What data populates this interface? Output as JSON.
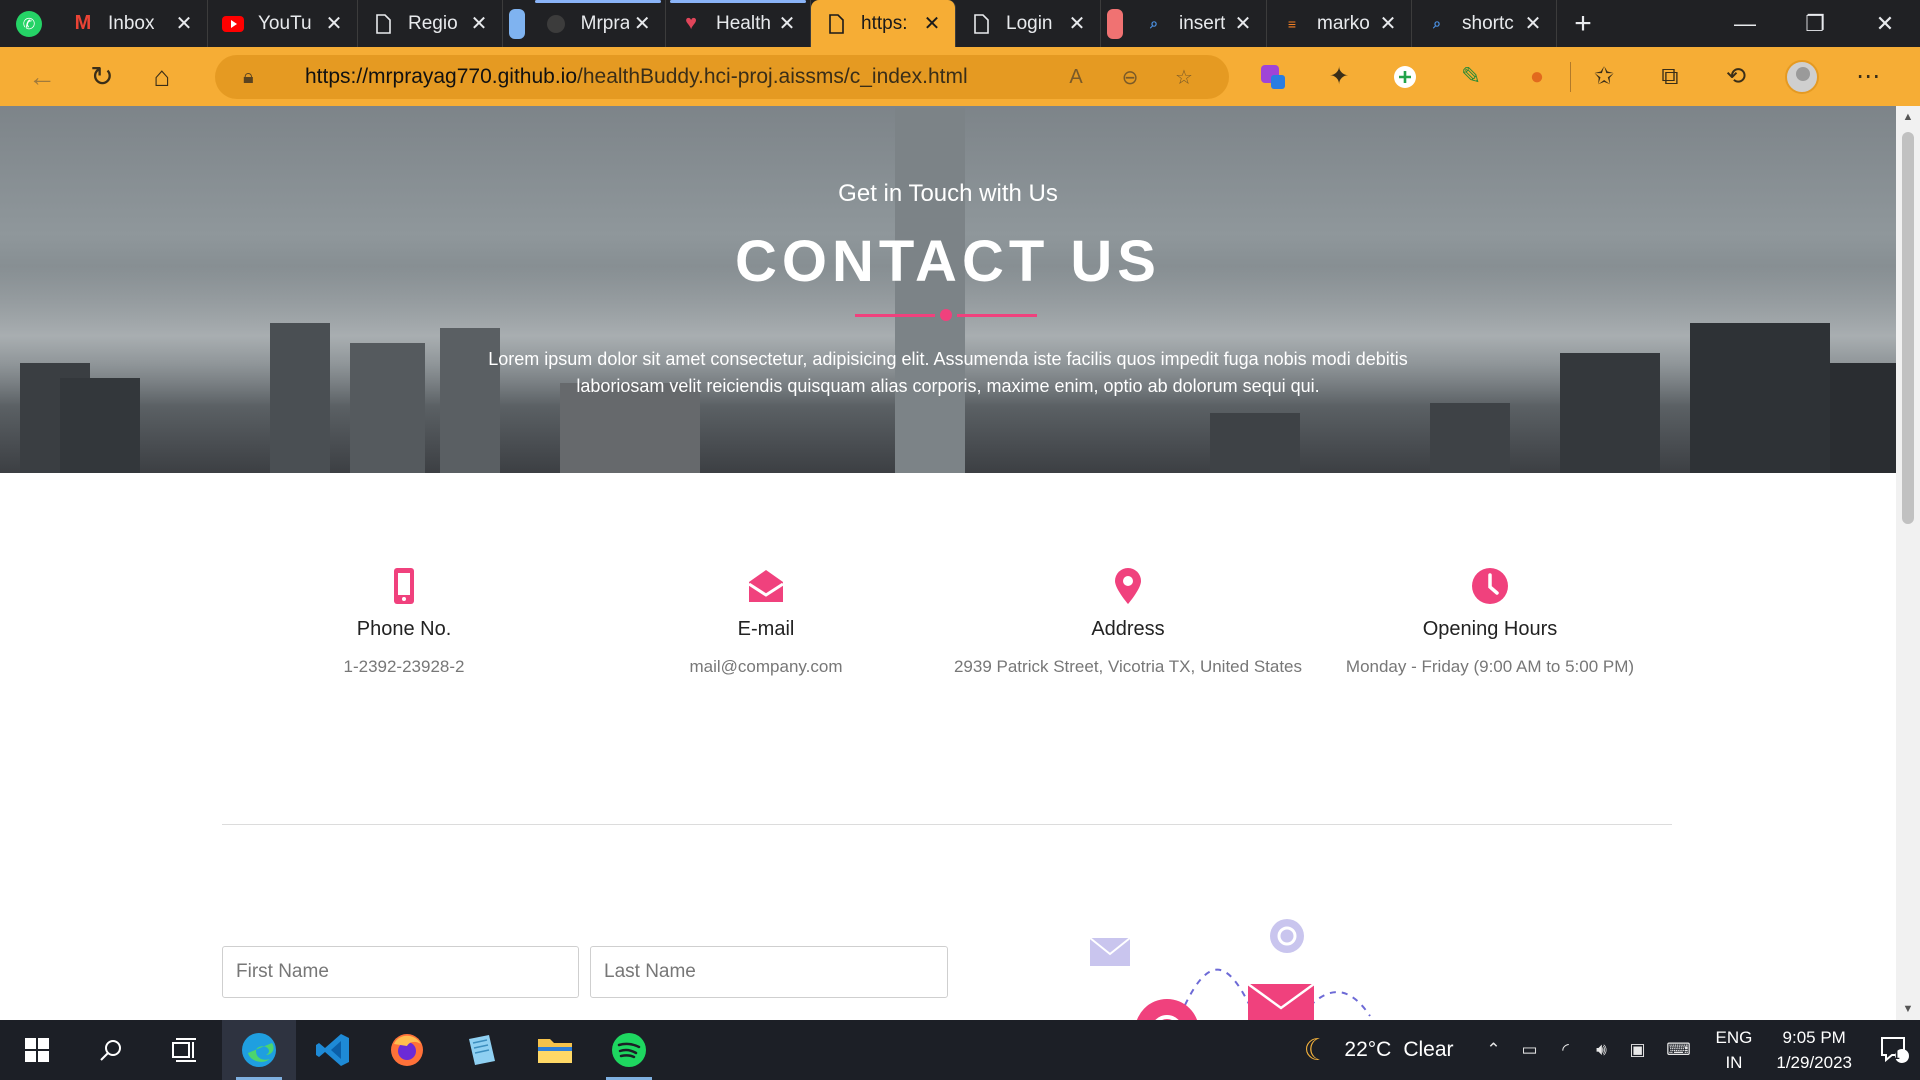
{
  "browser": {
    "tabs": [
      {
        "label": "Inbox",
        "icon": "gmail-icon"
      },
      {
        "label": "YouTu",
        "icon": "youtube-icon"
      },
      {
        "label": "Regio",
        "icon": "page-icon"
      },
      {
        "label": "Mrpra",
        "icon": "github-icon"
      },
      {
        "label": "Health",
        "icon": "heart-icon"
      },
      {
        "label": "https:",
        "icon": "page-icon"
      },
      {
        "label": "Login",
        "icon": "page-icon"
      },
      {
        "label": "insert",
        "icon": "search-icon"
      },
      {
        "label": "marko",
        "icon": "stackoverflow-icon"
      },
      {
        "label": "shortc",
        "icon": "search-icon"
      }
    ],
    "active_tab_index": 5,
    "url_domain": "https://mrprayag770.github.io",
    "url_path": "/healthBuddy.hci-proj.aissms/c_index.html",
    "accent": "#f6ad35"
  },
  "hero": {
    "subtitle": "Get in Touch with Us",
    "title": "CONTACT US",
    "text": "Lorem ipsum dolor sit amet consectetur, adipisicing elit. Assumenda iste facilis quos impedit fuga nobis modi debitis laboriosam velit reiciendis quisquam alias corporis, maxime enim, optio ab dolorum sequi qui.",
    "accent": "#f0417d"
  },
  "info": [
    {
      "title": "Phone No.",
      "value": "1-2392-23928-2",
      "icon": "phone-icon"
    },
    {
      "title": "E-mail",
      "value": "mail@company.com",
      "icon": "envelope-icon"
    },
    {
      "title": "Address",
      "value": "2939 Patrick Street, Vicotria TX, United States",
      "icon": "map-pin-icon"
    },
    {
      "title": "Opening Hours",
      "value": "Monday - Friday (9:00 AM to 5:00 PM)",
      "icon": "clock-icon"
    }
  ],
  "form": {
    "first_name_placeholder": "First Name",
    "last_name_placeholder": "Last Name"
  },
  "taskbar": {
    "weather": "22°C",
    "weather_text": "Clear",
    "lang_top": "ENG",
    "lang_bottom": "IN",
    "time": "9:05 PM",
    "date": "1/29/2023",
    "notification_count": "1"
  }
}
